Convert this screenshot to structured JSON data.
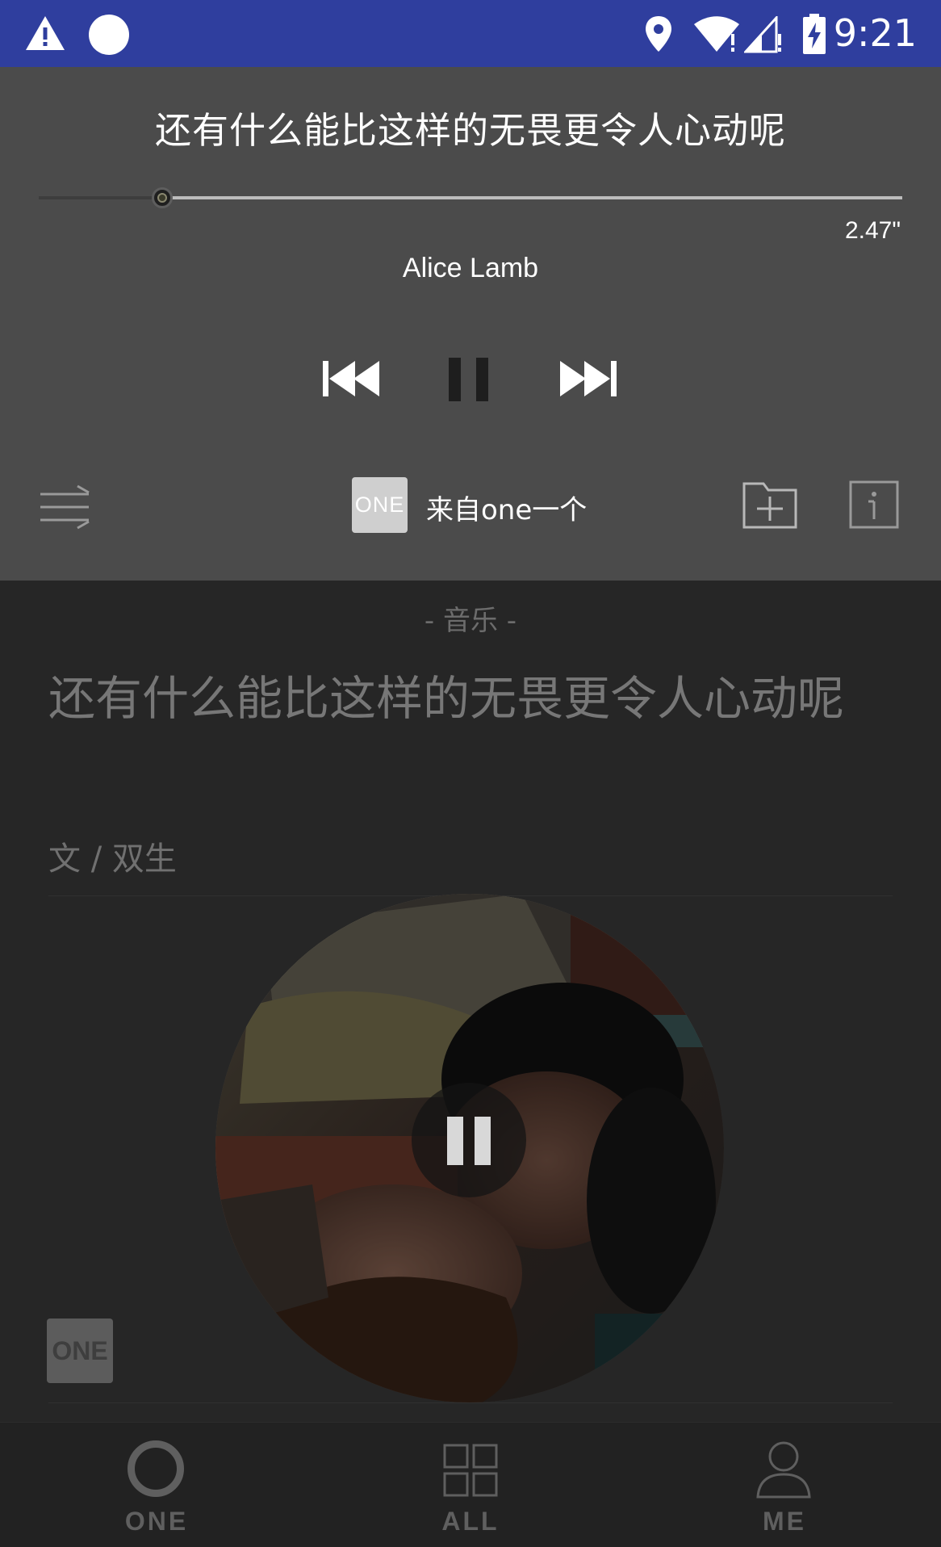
{
  "status_bar": {
    "time": "9:21",
    "icons": [
      "warning-icon",
      "circle-icon",
      "location-icon",
      "wifi-icon",
      "signal-icon",
      "battery-charging-icon"
    ]
  },
  "player": {
    "song_title": "还有什么能比这样的无畏更令人心动呢",
    "progress_fraction": 0.143,
    "duration": "2.47\"",
    "artist": "Alice Lamb",
    "controls": [
      "previous-icon",
      "pause-icon",
      "next-icon"
    ],
    "source_badge": "ONE",
    "source_label": "来自one一个",
    "left_icon": "playlist-icon",
    "right_icons": [
      "add-to-folder-icon",
      "info-icon"
    ]
  },
  "article": {
    "category": "- 音乐 -",
    "title": "还有什么能比这样的无畏更令人心动呢",
    "author": "文 / 双生",
    "logo_text": "ONE"
  },
  "bottom_nav": {
    "items": [
      {
        "label": "ONE",
        "icon": "ring-icon"
      },
      {
        "label": "ALL",
        "icon": "grid-icon"
      },
      {
        "label": "ME",
        "icon": "person-icon"
      }
    ]
  }
}
